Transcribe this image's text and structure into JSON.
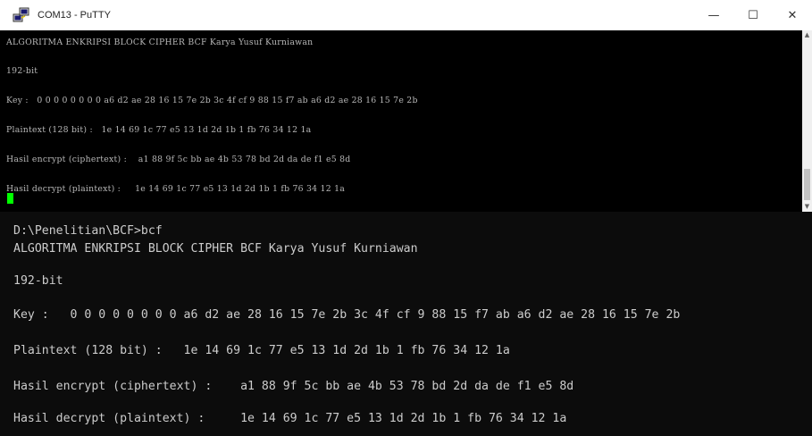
{
  "window": {
    "title": "COM13 - PuTTY",
    "icon": "putty-icon",
    "controls": {
      "minimize": "—",
      "maximize": "☐",
      "close": "✕"
    }
  },
  "putty": {
    "lines": [
      "ALGORITMA ENKRIPSI BLOCK CIPHER BCF Karya Yusuf Kurniawan",
      "192-bit",
      "Key :   0 0 0 0 0 0 0 0 a6 d2 ae 28 16 15 7e 2b 3c 4f cf 9 88 15 f7 ab a6 d2 ae 28 16 15 7e 2b",
      "Plaintext (128 bit) :   1e 14 69 1c 77 e5 13 1d 2d 1b 1 fb 76 34 12 1a",
      "Hasil encrypt (ciphertext) :    a1 88 9f 5c bb ae 4b 53 78 bd 2d da de f1 e5 8d",
      "Hasil decrypt (plaintext) :     1e 14 69 1c 77 e5 13 1d 2d 1b 1 fb 76 34 12 1a"
    ],
    "cursor_color": "#00ff00"
  },
  "console": {
    "lines": [
      "D:\\Penelitian\\BCF>bcf",
      "ALGORITMA ENKRIPSI BLOCK CIPHER BCF Karya Yusuf Kurniawan",
      "192-bit",
      "Key :   0 0 0 0 0 0 0 0 a6 d2 ae 28 16 15 7e 2b 3c 4f cf 9 88 15 f7 ab a6 d2 ae 28 16 15 7e 2b",
      "Plaintext (128 bit) :   1e 14 69 1c 77 e5 13 1d 2d 1b 1 fb 76 34 12 1a",
      "Hasil encrypt (ciphertext) :    a1 88 9f 5c bb ae 4b 53 78 bd 2d da de f1 e5 8d",
      "Hasil decrypt (plaintext) :     1e 14 69 1c 77 e5 13 1d 2d 1b 1 fb 76 34 12 1a"
    ]
  },
  "colors": {
    "putty_background": "#000000",
    "putty_text": "#b8b8b8",
    "console_background": "#0c0c0c",
    "console_text": "#cccccc"
  }
}
